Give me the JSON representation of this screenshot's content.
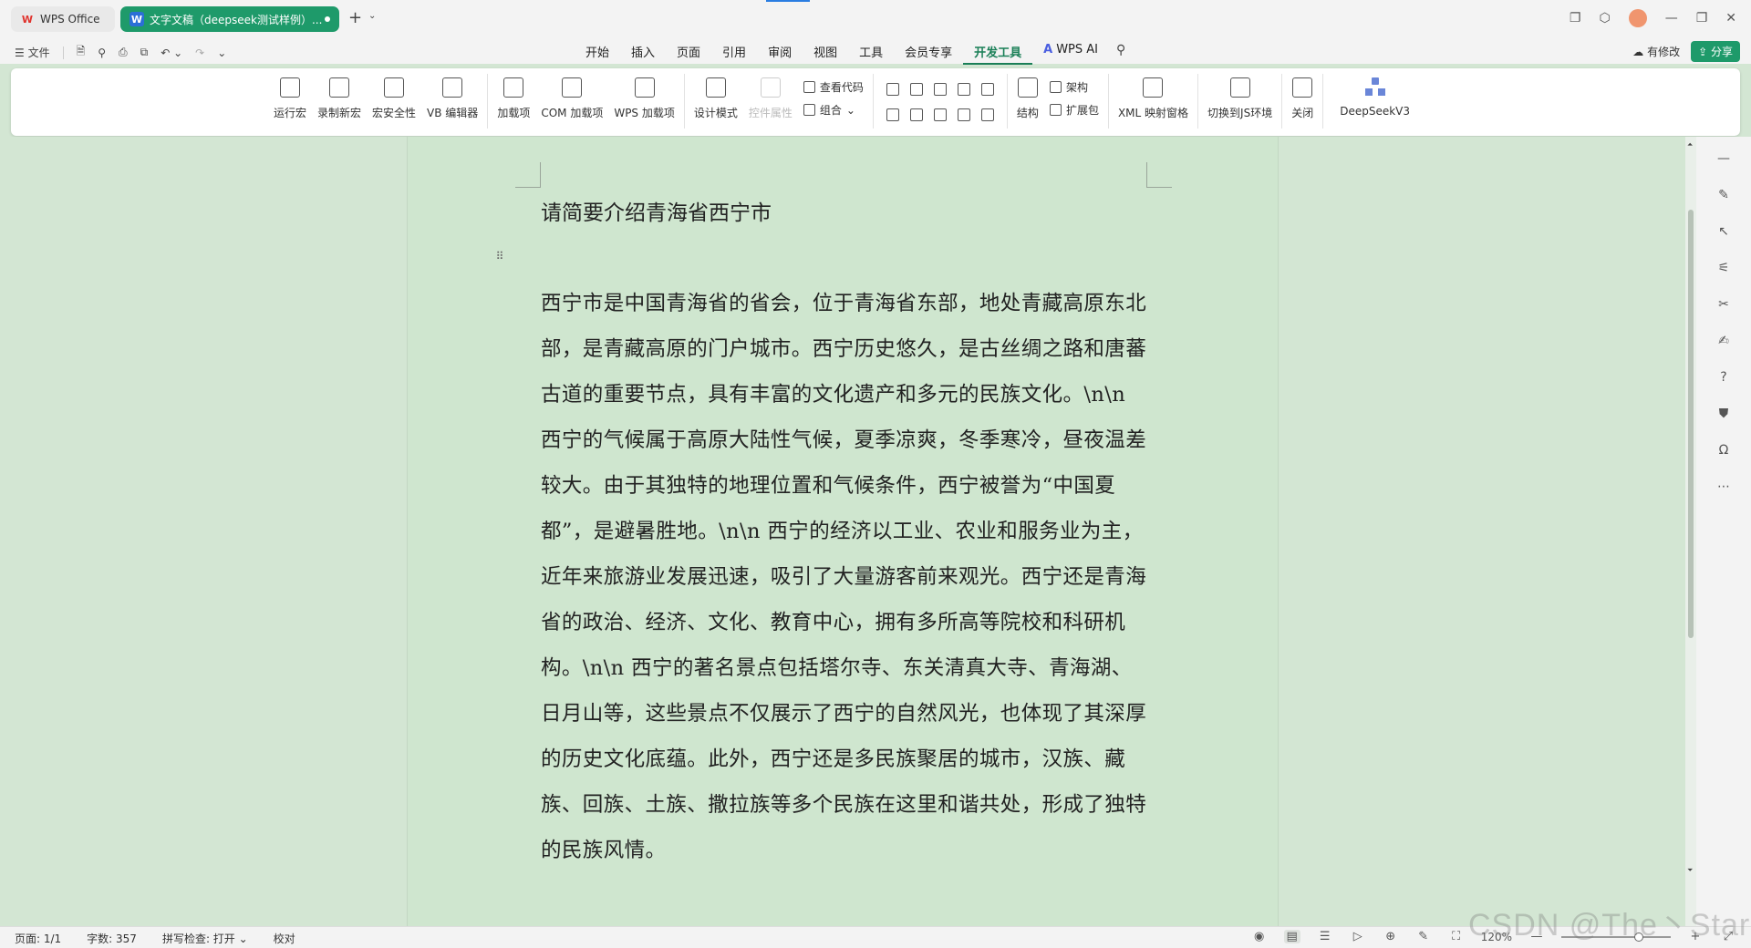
{
  "titlebar": {
    "tab_wps_logo": "W",
    "tab_wps": "WPS Office",
    "tab_doc_logo": "W",
    "tab_doc": "文字文稿（deepseek测试样例）..."
  },
  "menubar": {
    "file": "☰ 文件",
    "items": [
      "开始",
      "插入",
      "页面",
      "引用",
      "审阅",
      "视图",
      "工具",
      "会员专享",
      "开发工具",
      "WPS AI"
    ],
    "active": "开发工具",
    "modify": "有修改",
    "share": "分享"
  },
  "ribbon": {
    "run_macro": "运行宏",
    "record_macro": "录制新宏",
    "macro_security": "宏安全性",
    "vb_editor": "VB 编辑器",
    "addins": "加载项",
    "com_addins": "COM 加载项",
    "wps_addins": "WPS 加载项",
    "design_mode": "设计模式",
    "control_props": "控件属性",
    "view_code": "查看代码",
    "group": "组合",
    "structure": "结构",
    "schema": "架构",
    "ext_pack": "扩展包",
    "xml_mapping": "XML 映射窗格",
    "switch_js": "切换到JS环境",
    "close": "关闭",
    "deepseek": "DeepSeekV3"
  },
  "document": {
    "question": "请简要介绍青海省西宁市",
    "body": "西宁市是中国青海省的省会，位于青海省东部，地处青藏高原东北部，是青藏高原的门户城市。西宁历史悠久，是古丝绸之路和唐蕃古道的重要节点，具有丰富的文化遗产和多元的民族文化。\\n\\n 西宁的气候属于高原大陆性气候，夏季凉爽，冬季寒冷，昼夜温差较大。由于其独特的地理位置和气候条件，西宁被誉为“中国夏都”，是避暑胜地。\\n\\n 西宁的经济以工业、农业和服务业为主，近年来旅游业发展迅速，吸引了大量游客前来观光。西宁还是青海省的政治、经济、文化、教育中心，拥有多所高等院校和科研机构。\\n\\n 西宁的著名景点包括塔尔寺、东关清真大寺、青海湖、日月山等，这些景点不仅展示了西宁的自然风光，也体现了其深厚的历史文化底蕴。此外，西宁还是多民族聚居的城市，汉族、藏族、回族、土族、撒拉族等多个民族在这里和谐共处，形成了独特的民族风情。"
  },
  "statusbar": {
    "page": "页面: 1/1",
    "words": "字数: 357",
    "spell": "拼写检查: 打开 ⌄",
    "proof": "校对",
    "zoom": "120%"
  },
  "watermark": "CSDN @The丶Star",
  "colors": {
    "accent": "#1e9a6a",
    "page_bg": "#cfe6cf"
  }
}
